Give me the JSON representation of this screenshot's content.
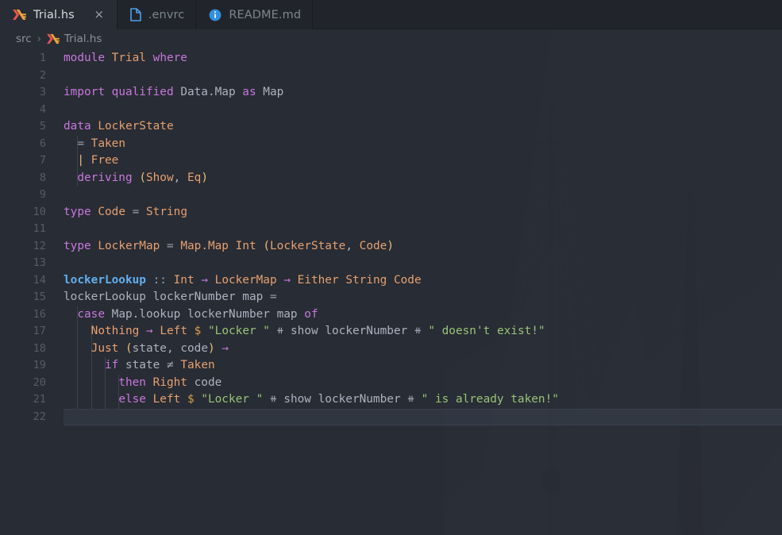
{
  "window": {
    "title": "Trial.hs"
  },
  "tabs": [
    {
      "label": "Trial.hs",
      "icon": "haskell-icon",
      "active": true,
      "closable": true,
      "close_glyph": "×"
    },
    {
      "label": ".envrc",
      "icon": "file-icon",
      "active": false,
      "closable": false,
      "close_glyph": ""
    },
    {
      "label": "README.md",
      "icon": "info-icon",
      "active": false,
      "closable": false,
      "close_glyph": ""
    }
  ],
  "breadcrumb": {
    "items": [
      {
        "label": "src",
        "icon": ""
      },
      {
        "label": "Trial.hs",
        "icon": "haskell-icon"
      }
    ],
    "separator": "›"
  },
  "editor": {
    "language": "haskell",
    "current_line": 22,
    "line_count": 22,
    "lines": [
      {
        "n": 1,
        "tokens": [
          {
            "t": "module",
            "c": "kw"
          },
          {
            "t": " ",
            "c": "id"
          },
          {
            "t": "Trial",
            "c": "typ"
          },
          {
            "t": " ",
            "c": "id"
          },
          {
            "t": "where",
            "c": "kw"
          }
        ]
      },
      {
        "n": 2,
        "tokens": []
      },
      {
        "n": 3,
        "tokens": [
          {
            "t": "import",
            "c": "kw"
          },
          {
            "t": " ",
            "c": "id"
          },
          {
            "t": "qualified",
            "c": "kw"
          },
          {
            "t": " ",
            "c": "id"
          },
          {
            "t": "Data.Map",
            "c": "id"
          },
          {
            "t": " ",
            "c": "id"
          },
          {
            "t": "as",
            "c": "kw"
          },
          {
            "t": " ",
            "c": "id"
          },
          {
            "t": "Map",
            "c": "id"
          }
        ]
      },
      {
        "n": 4,
        "tokens": []
      },
      {
        "n": 5,
        "tokens": [
          {
            "t": "data",
            "c": "kw"
          },
          {
            "t": " ",
            "c": "id"
          },
          {
            "t": "LockerState",
            "c": "typ"
          }
        ]
      },
      {
        "n": 6,
        "tokens": [
          {
            "t": "  ",
            "c": "id"
          },
          {
            "t": "=",
            "c": "op"
          },
          {
            "t": " ",
            "c": "id"
          },
          {
            "t": "Taken",
            "c": "typ"
          }
        ]
      },
      {
        "n": 7,
        "tokens": [
          {
            "t": "  ",
            "c": "id"
          },
          {
            "t": "|",
            "c": "par"
          },
          {
            "t": " ",
            "c": "id"
          },
          {
            "t": "Free",
            "c": "typ"
          }
        ]
      },
      {
        "n": 8,
        "tokens": [
          {
            "t": "  ",
            "c": "id"
          },
          {
            "t": "deriving",
            "c": "kw"
          },
          {
            "t": " ",
            "c": "id"
          },
          {
            "t": "(",
            "c": "par"
          },
          {
            "t": "Show",
            "c": "typ"
          },
          {
            "t": ",",
            "c": "pun"
          },
          {
            "t": " ",
            "c": "id"
          },
          {
            "t": "Eq",
            "c": "typ"
          },
          {
            "t": ")",
            "c": "par"
          }
        ]
      },
      {
        "n": 9,
        "tokens": []
      },
      {
        "n": 10,
        "tokens": [
          {
            "t": "type",
            "c": "kw"
          },
          {
            "t": " ",
            "c": "id"
          },
          {
            "t": "Code",
            "c": "typ"
          },
          {
            "t": " ",
            "c": "id"
          },
          {
            "t": "=",
            "c": "op"
          },
          {
            "t": " ",
            "c": "id"
          },
          {
            "t": "String",
            "c": "typ"
          }
        ]
      },
      {
        "n": 11,
        "tokens": []
      },
      {
        "n": 12,
        "tokens": [
          {
            "t": "type",
            "c": "kw"
          },
          {
            "t": " ",
            "c": "id"
          },
          {
            "t": "LockerMap",
            "c": "typ"
          },
          {
            "t": " ",
            "c": "id"
          },
          {
            "t": "=",
            "c": "op"
          },
          {
            "t": " ",
            "c": "id"
          },
          {
            "t": "Map.Map",
            "c": "typ"
          },
          {
            "t": " ",
            "c": "id"
          },
          {
            "t": "Int",
            "c": "typ"
          },
          {
            "t": " ",
            "c": "id"
          },
          {
            "t": "(",
            "c": "par"
          },
          {
            "t": "LockerState",
            "c": "typ"
          },
          {
            "t": ",",
            "c": "pun"
          },
          {
            "t": " ",
            "c": "id"
          },
          {
            "t": "Code",
            "c": "typ"
          },
          {
            "t": ")",
            "c": "par"
          }
        ]
      },
      {
        "n": 13,
        "tokens": []
      },
      {
        "n": 14,
        "tokens": [
          {
            "t": "lockerLookup",
            "c": "fn"
          },
          {
            "t": " ",
            "c": "id"
          },
          {
            "t": "::",
            "c": "op"
          },
          {
            "t": " ",
            "c": "id"
          },
          {
            "t": "Int",
            "c": "typ"
          },
          {
            "t": " ",
            "c": "id"
          },
          {
            "t": "→",
            "c": "opp"
          },
          {
            "t": " ",
            "c": "id"
          },
          {
            "t": "LockerMap",
            "c": "typ"
          },
          {
            "t": " ",
            "c": "id"
          },
          {
            "t": "→",
            "c": "opp"
          },
          {
            "t": " ",
            "c": "id"
          },
          {
            "t": "Either",
            "c": "typ"
          },
          {
            "t": " ",
            "c": "id"
          },
          {
            "t": "String",
            "c": "typ"
          },
          {
            "t": " ",
            "c": "id"
          },
          {
            "t": "Code",
            "c": "typ"
          }
        ]
      },
      {
        "n": 15,
        "tokens": [
          {
            "t": "lockerLookup",
            "c": "id"
          },
          {
            "t": " ",
            "c": "id"
          },
          {
            "t": "lockerNumber",
            "c": "id"
          },
          {
            "t": " ",
            "c": "id"
          },
          {
            "t": "map",
            "c": "id"
          },
          {
            "t": " ",
            "c": "id"
          },
          {
            "t": "=",
            "c": "op"
          }
        ]
      },
      {
        "n": 16,
        "tokens": [
          {
            "t": "  ",
            "c": "id"
          },
          {
            "t": "case",
            "c": "kw"
          },
          {
            "t": " ",
            "c": "id"
          },
          {
            "t": "Map.lookup",
            "c": "id"
          },
          {
            "t": " ",
            "c": "id"
          },
          {
            "t": "lockerNumber",
            "c": "id"
          },
          {
            "t": " ",
            "c": "id"
          },
          {
            "t": "map",
            "c": "id"
          },
          {
            "t": " ",
            "c": "id"
          },
          {
            "t": "of",
            "c": "kw"
          }
        ]
      },
      {
        "n": 17,
        "tokens": [
          {
            "t": "    ",
            "c": "id"
          },
          {
            "t": "Nothing",
            "c": "typ"
          },
          {
            "t": " ",
            "c": "id"
          },
          {
            "t": "→",
            "c": "opp"
          },
          {
            "t": " ",
            "c": "id"
          },
          {
            "t": "Left",
            "c": "typ"
          },
          {
            "t": " ",
            "c": "id"
          },
          {
            "t": "$",
            "c": "dol"
          },
          {
            "t": " ",
            "c": "id"
          },
          {
            "t": "\"Locker \"",
            "c": "str"
          },
          {
            "t": " ",
            "c": "id"
          },
          {
            "t": "⧺",
            "c": "op"
          },
          {
            "t": " ",
            "c": "id"
          },
          {
            "t": "show",
            "c": "id"
          },
          {
            "t": " ",
            "c": "id"
          },
          {
            "t": "lockerNumber",
            "c": "id"
          },
          {
            "t": " ",
            "c": "id"
          },
          {
            "t": "⧺",
            "c": "op"
          },
          {
            "t": " ",
            "c": "id"
          },
          {
            "t": "\" doesn't exist!\"",
            "c": "str"
          }
        ]
      },
      {
        "n": 18,
        "tokens": [
          {
            "t": "    ",
            "c": "id"
          },
          {
            "t": "Just",
            "c": "typ"
          },
          {
            "t": " ",
            "c": "id"
          },
          {
            "t": "(",
            "c": "par"
          },
          {
            "t": "state",
            "c": "id"
          },
          {
            "t": ",",
            "c": "pun"
          },
          {
            "t": " ",
            "c": "id"
          },
          {
            "t": "code",
            "c": "id"
          },
          {
            "t": ")",
            "c": "par"
          },
          {
            "t": " ",
            "c": "id"
          },
          {
            "t": "→",
            "c": "opp"
          }
        ]
      },
      {
        "n": 19,
        "tokens": [
          {
            "t": "      ",
            "c": "id"
          },
          {
            "t": "if",
            "c": "kw"
          },
          {
            "t": " ",
            "c": "id"
          },
          {
            "t": "state",
            "c": "id"
          },
          {
            "t": " ",
            "c": "id"
          },
          {
            "t": "≠",
            "c": "op"
          },
          {
            "t": " ",
            "c": "id"
          },
          {
            "t": "Taken",
            "c": "typ"
          }
        ]
      },
      {
        "n": 20,
        "tokens": [
          {
            "t": "        ",
            "c": "id"
          },
          {
            "t": "then",
            "c": "kw"
          },
          {
            "t": " ",
            "c": "id"
          },
          {
            "t": "Right",
            "c": "typ"
          },
          {
            "t": " ",
            "c": "id"
          },
          {
            "t": "code",
            "c": "id"
          }
        ]
      },
      {
        "n": 21,
        "tokens": [
          {
            "t": "        ",
            "c": "id"
          },
          {
            "t": "else",
            "c": "kw"
          },
          {
            "t": " ",
            "c": "id"
          },
          {
            "t": "Left",
            "c": "typ"
          },
          {
            "t": " ",
            "c": "id"
          },
          {
            "t": "$",
            "c": "dol"
          },
          {
            "t": " ",
            "c": "id"
          },
          {
            "t": "\"Locker \"",
            "c": "str"
          },
          {
            "t": " ",
            "c": "id"
          },
          {
            "t": "⧺",
            "c": "op"
          },
          {
            "t": " ",
            "c": "id"
          },
          {
            "t": "show",
            "c": "id"
          },
          {
            "t": " ",
            "c": "id"
          },
          {
            "t": "lockerNumber",
            "c": "id"
          },
          {
            "t": " ",
            "c": "id"
          },
          {
            "t": "⧺",
            "c": "op"
          },
          {
            "t": " ",
            "c": "id"
          },
          {
            "t": "\" is already taken!\"",
            "c": "str"
          }
        ]
      },
      {
        "n": 22,
        "tokens": []
      }
    ],
    "indent_guides": [
      {
        "col": 2,
        "from": 6,
        "to": 8
      },
      {
        "col": 2,
        "from": 16,
        "to": 21
      },
      {
        "col": 4,
        "from": 17,
        "to": 21
      },
      {
        "col": 6,
        "from": 19,
        "to": 21
      },
      {
        "col": 8,
        "from": 20,
        "to": 21
      }
    ]
  },
  "colors": {
    "editor_background": "#282c34",
    "tabbar_background": "#21252b",
    "active_tab_background": "#282c34",
    "keyword": "#c678dd",
    "type": "#e5a070",
    "function": "#61afef",
    "string": "#98c379",
    "identifier": "#abb2bf",
    "paren": "#e5c07b",
    "line_number": "#565c66",
    "file_icon": "#4d9fe8",
    "haskell_icon_red": "#e8544f",
    "haskell_icon_orange": "#f4a93c"
  }
}
